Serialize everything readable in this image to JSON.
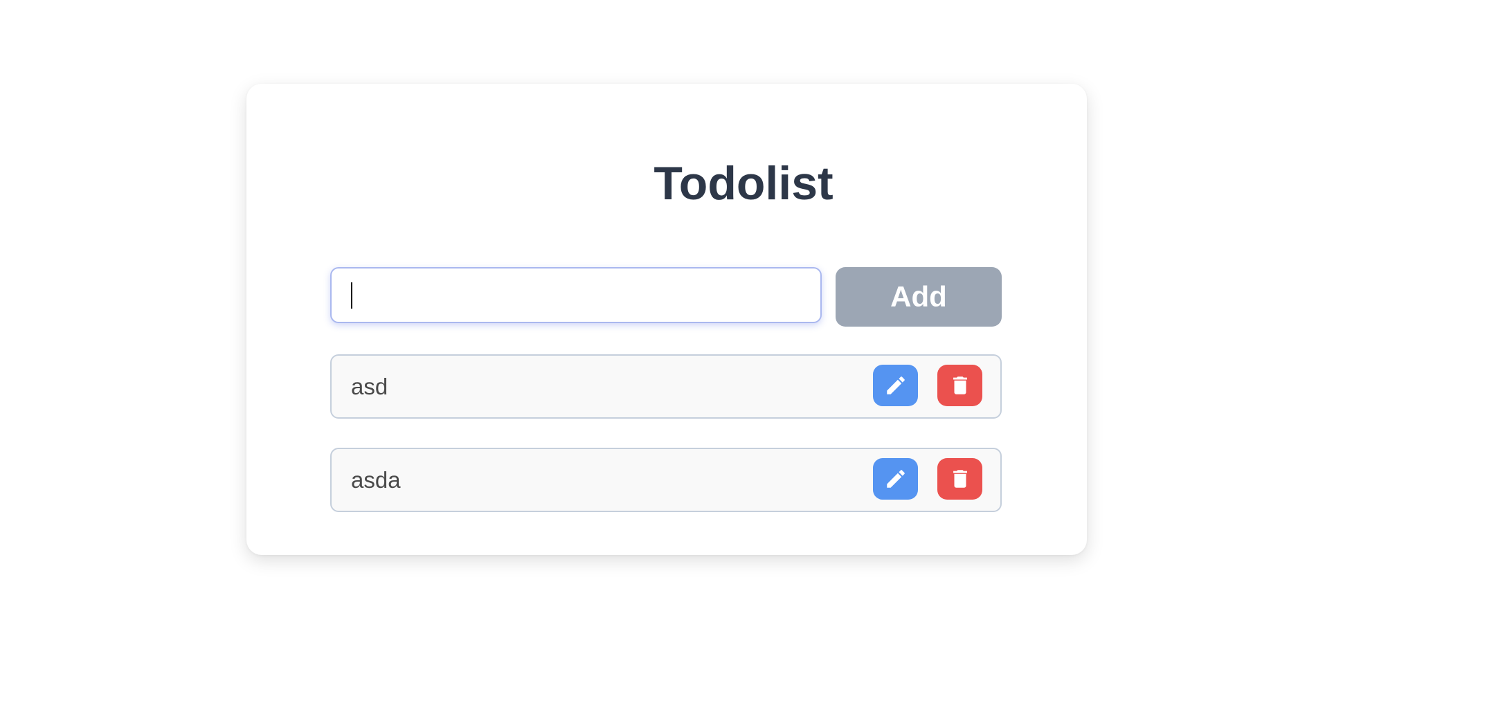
{
  "app": {
    "title": "Todolist"
  },
  "input": {
    "value": "",
    "placeholder": ""
  },
  "add_button": {
    "label": "Add"
  },
  "todos": [
    {
      "text": "asd",
      "edit_icon": "pencil-icon",
      "delete_icon": "trash-icon"
    },
    {
      "text": "asda",
      "edit_icon": "pencil-icon",
      "delete_icon": "trash-icon"
    }
  ],
  "colors": {
    "title": "#2d3748",
    "add_button": "#9ca6b4",
    "edit_button": "#5594f1",
    "delete_button": "#eb514e",
    "item_background": "#f9f9f9",
    "input_focus_border": "#aab8ef"
  }
}
